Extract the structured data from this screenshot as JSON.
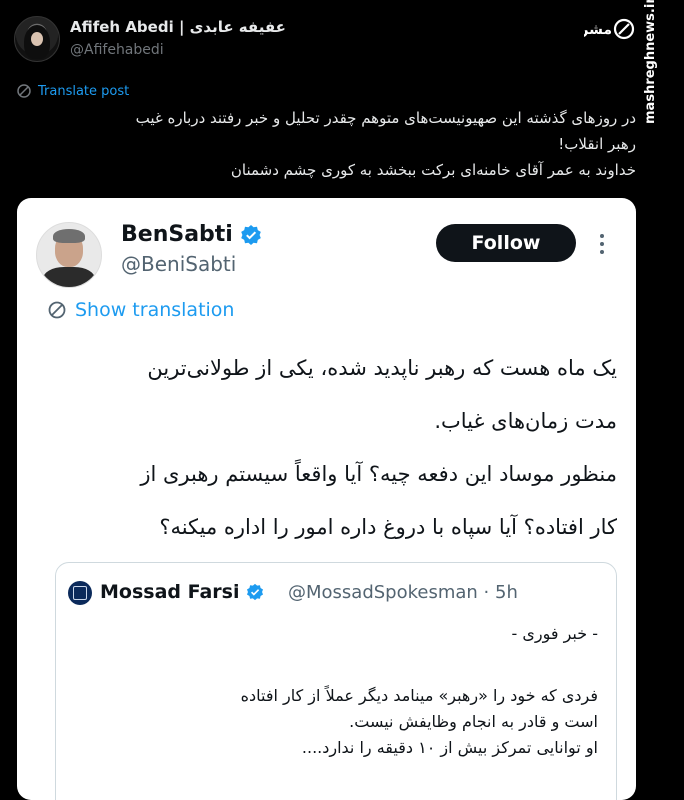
{
  "outer_post": {
    "display_name": "Afifeh Abedi | عفیفه عابدی",
    "handle": "@Afifehabedi",
    "translate_label": "Translate post",
    "text_lines": [
      "در روزهای گذشته این صهیونیست‌های متوهم چقدر تحلیل و خبر رفتند درباره غیب",
      "رهبر انقلاب!",
      "خداوند به عمر آقای خامنه‌ای برکت ببخشد به کوری چشم دشمنان"
    ]
  },
  "watermark": {
    "site": "mashreghnews.ir",
    "logo_text": "مشرق"
  },
  "quoted_card": {
    "display_name": "BenSabti",
    "handle": "@BeniSabti",
    "follow_label": "Follow",
    "show_translation_label": "Show translation",
    "text_lines": [
      "یک ماه هست که رهبر ناپدید شده، یکی از طولانی‌ترین",
      "مدت زمان‌های غیاب.",
      "منظور موساد این دفعه چیه؟ آیا واقعاً سیستم رهبری از",
      "کار افتاده؟ آیا سپاه با دروغ داره امور را اداره میکنه؟"
    ],
    "nested_quote": {
      "display_name": "Mossad Farsi",
      "handle_time": "@MossadSpokesman · 5h",
      "header_line": "- خبر فوری -",
      "body_lines": [
        "فردی که خود را «رهبر» مینامد دیگر عملاً از کار افتاده",
        "است و قادر به انجام وظایفش نیست.",
        "او توانایی تمرکز بیش از ۱۰ دقیقه را ندارد...."
      ]
    }
  },
  "colors": {
    "background": "#000000",
    "link_blue": "#1d9bf0",
    "card_background": "#ffffff",
    "verified_blue": "#1d9bf0"
  }
}
